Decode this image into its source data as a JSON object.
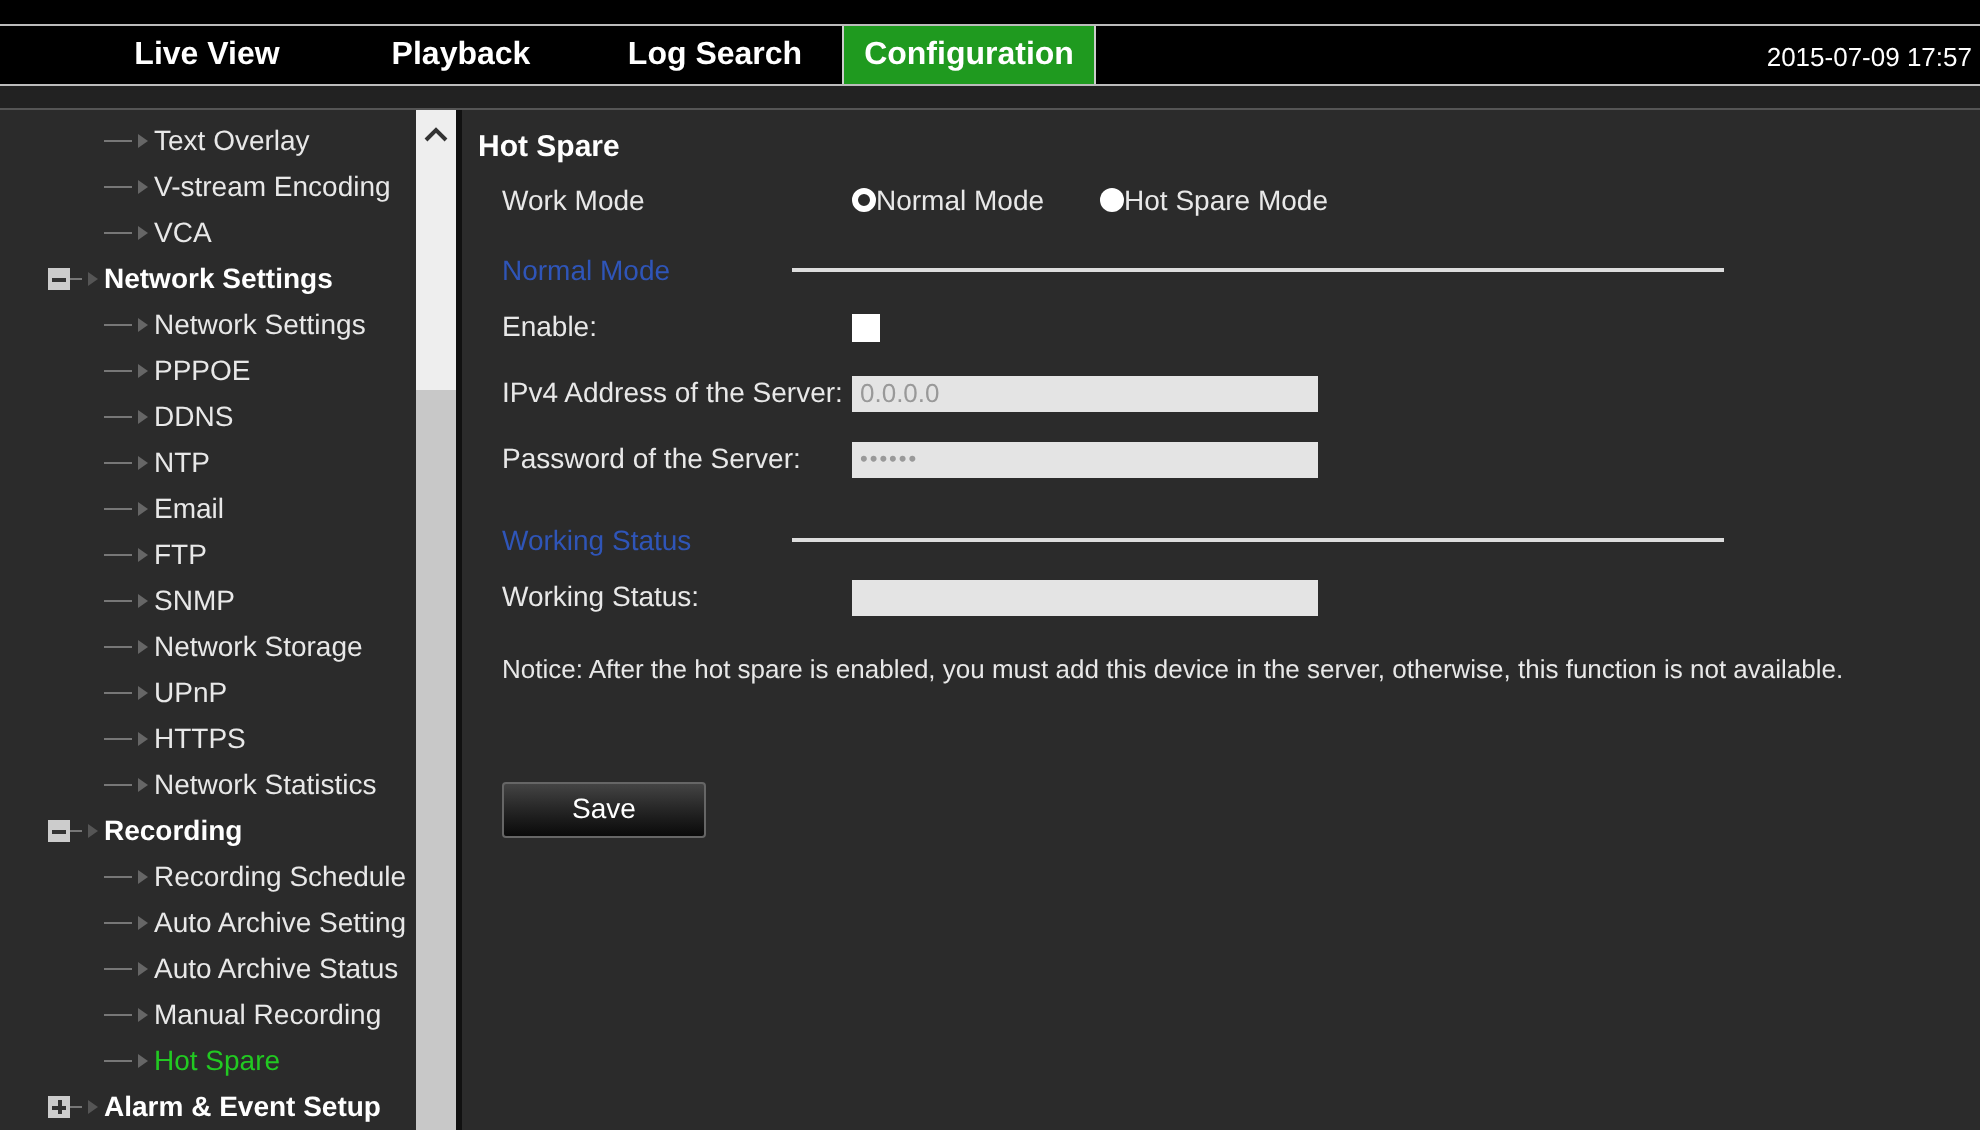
{
  "nav": {
    "tabs": [
      {
        "label": "Live View",
        "selected": false
      },
      {
        "label": "Playback",
        "selected": false
      },
      {
        "label": "Log Search",
        "selected": false
      },
      {
        "label": "Configuration",
        "selected": true
      }
    ],
    "datetime": "2015-07-09 17:57"
  },
  "sidebar": {
    "items": [
      {
        "label": "Text Overlay",
        "selected": false
      },
      {
        "label": "V-stream Encoding",
        "selected": false
      },
      {
        "label": "VCA",
        "selected": false
      },
      {
        "kind": "group",
        "label": "Network Settings",
        "expanded": true,
        "children": [
          {
            "label": "Network Settings",
            "selected": false
          },
          {
            "label": "PPPOE",
            "selected": false
          },
          {
            "label": "DDNS",
            "selected": false
          },
          {
            "label": "NTP",
            "selected": false
          },
          {
            "label": "Email",
            "selected": false
          },
          {
            "label": "FTP",
            "selected": false
          },
          {
            "label": "SNMP",
            "selected": false
          },
          {
            "label": "Network Storage",
            "selected": false
          },
          {
            "label": "UPnP",
            "selected": false
          },
          {
            "label": "HTTPS",
            "selected": false
          },
          {
            "label": "Network Statistics",
            "selected": false
          }
        ]
      },
      {
        "kind": "group",
        "label": "Recording",
        "expanded": true,
        "children": [
          {
            "label": "Recording Schedule",
            "selected": false
          },
          {
            "label": "Auto Archive Setting",
            "selected": false
          },
          {
            "label": "Auto Archive Status",
            "selected": false
          },
          {
            "label": "Manual Recording",
            "selected": false
          },
          {
            "label": "Hot Spare",
            "selected": true
          }
        ]
      },
      {
        "kind": "group",
        "label": "Alarm & Event Setup",
        "expanded": false
      }
    ]
  },
  "content": {
    "title": "Hot Spare",
    "work_mode": {
      "label": "Work Mode",
      "options": [
        {
          "label": "Normal Mode",
          "selected": true
        },
        {
          "label": "Hot Spare Mode",
          "selected": false
        }
      ]
    },
    "sections": [
      {
        "heading": "Normal Mode",
        "fields": [
          {
            "kind": "checkbox",
            "label": "Enable:",
            "checked": false
          },
          {
            "kind": "text",
            "label": "IPv4 Address of the Server:",
            "value": "0.0.0.0"
          },
          {
            "kind": "password",
            "label": "Password of the Server:",
            "value": "••••••"
          }
        ]
      },
      {
        "heading": "Working Status",
        "fields": [
          {
            "kind": "text",
            "label": "Working Status:"
          }
        ]
      }
    ],
    "notice": "Notice: After the hot spare is enabled, you must add this device in the server, otherwise, this function is not available.",
    "save": "Save"
  }
}
